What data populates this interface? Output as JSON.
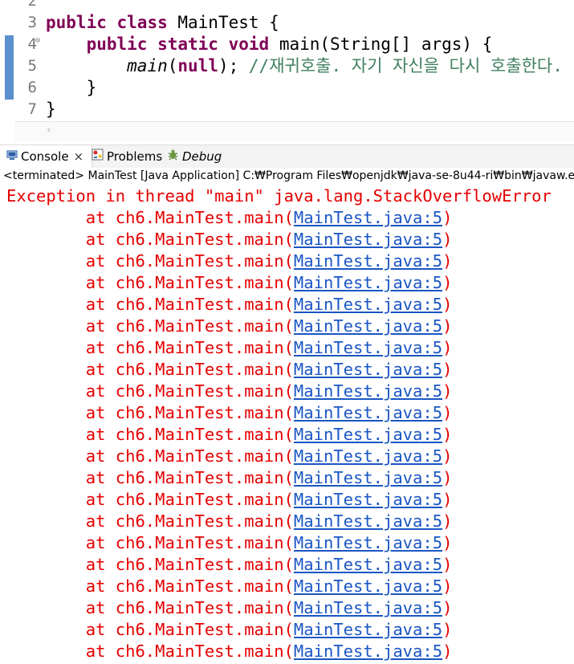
{
  "editor": {
    "lines": [
      {
        "num": "2",
        "tokens": []
      },
      {
        "num": "3",
        "tokens": [
          {
            "t": "public",
            "c": "kw"
          },
          {
            "t": " ",
            "c": ""
          },
          {
            "t": "class",
            "c": "kw"
          },
          {
            "t": " MainTest {",
            "c": ""
          }
        ]
      },
      {
        "num": "4",
        "fold": "⊖",
        "tokens": [
          {
            "t": "    ",
            "c": ""
          },
          {
            "t": "public",
            "c": "kw"
          },
          {
            "t": " ",
            "c": ""
          },
          {
            "t": "static",
            "c": "kw"
          },
          {
            "t": " ",
            "c": ""
          },
          {
            "t": "void",
            "c": "kw"
          },
          {
            "t": " main(String[] args) {",
            "c": ""
          }
        ]
      },
      {
        "num": "5",
        "tokens": [
          {
            "t": "        ",
            "c": ""
          },
          {
            "t": "main",
            "c": "mcall"
          },
          {
            "t": "(",
            "c": ""
          },
          {
            "t": "null",
            "c": "kw"
          },
          {
            "t": "); ",
            "c": ""
          },
          {
            "t": "//재귀호출. 자기 자신을 다시 호출한다.",
            "c": "cmt"
          }
        ]
      },
      {
        "num": "6",
        "tokens": [
          {
            "t": "    }",
            "c": ""
          }
        ]
      },
      {
        "num": "7",
        "tokens": [
          {
            "t": "}",
            "c": ""
          }
        ]
      }
    ]
  },
  "tabs": [
    {
      "label": "Console",
      "icon": "console-icon",
      "close": "×",
      "active": true
    },
    {
      "label": "Problems",
      "icon": "problems-icon",
      "active": false
    },
    {
      "label": "Debug",
      "icon": "debug-icon",
      "active": false
    }
  ],
  "console": {
    "status": "<terminated> MainTest [Java Application] C:₩Program Files₩openjdk₩java-se-8u44-ri₩bin₩javaw.exe",
    "exception": "Exception in thread \"main\" java.lang.StackOverflowError",
    "trace_prefix": "        at ch6.MainTest.main(",
    "trace_link": "MainTest.java:5",
    "trace_suffix": ")",
    "trace_count": 21
  },
  "colors": {
    "error_text": "#e60000",
    "link": "#1a56c4",
    "keyword": "#7f0055",
    "comment": "#3f7f5f",
    "gutter_marker": "#5c8fce"
  }
}
